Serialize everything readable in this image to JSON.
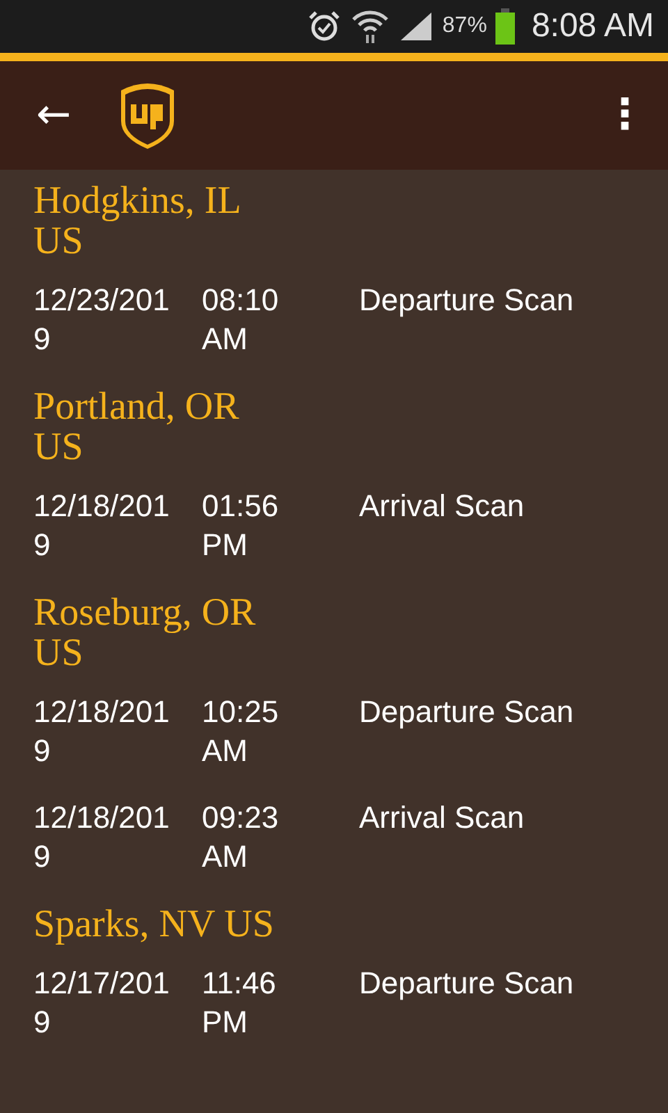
{
  "status_bar": {
    "battery": "87%",
    "time": "8:08 AM"
  },
  "app_bar": {
    "back": "←",
    "menu": "⋮"
  },
  "locations": [
    {
      "place": "Hodgkins, IL US",
      "events": [
        {
          "date": "12/23/2019",
          "time": "08:10 AM",
          "activity": "Departure Scan"
        }
      ]
    },
    {
      "place": "Portland, OR US",
      "events": [
        {
          "date": "12/18/2019",
          "time": "01:56 PM",
          "activity": "Arrival Scan"
        }
      ]
    },
    {
      "place": "Roseburg, OR US",
      "events": [
        {
          "date": "12/18/2019",
          "time": "10:25 AM",
          "activity": "Departure Scan"
        },
        {
          "date": "12/18/2019",
          "time": "09:23 AM",
          "activity": "Arrival Scan"
        }
      ]
    },
    {
      "place": "Sparks, NV US",
      "events": [
        {
          "date": "12/17/2019",
          "time": "11:46 PM",
          "activity": "Departure Scan"
        }
      ]
    }
  ]
}
